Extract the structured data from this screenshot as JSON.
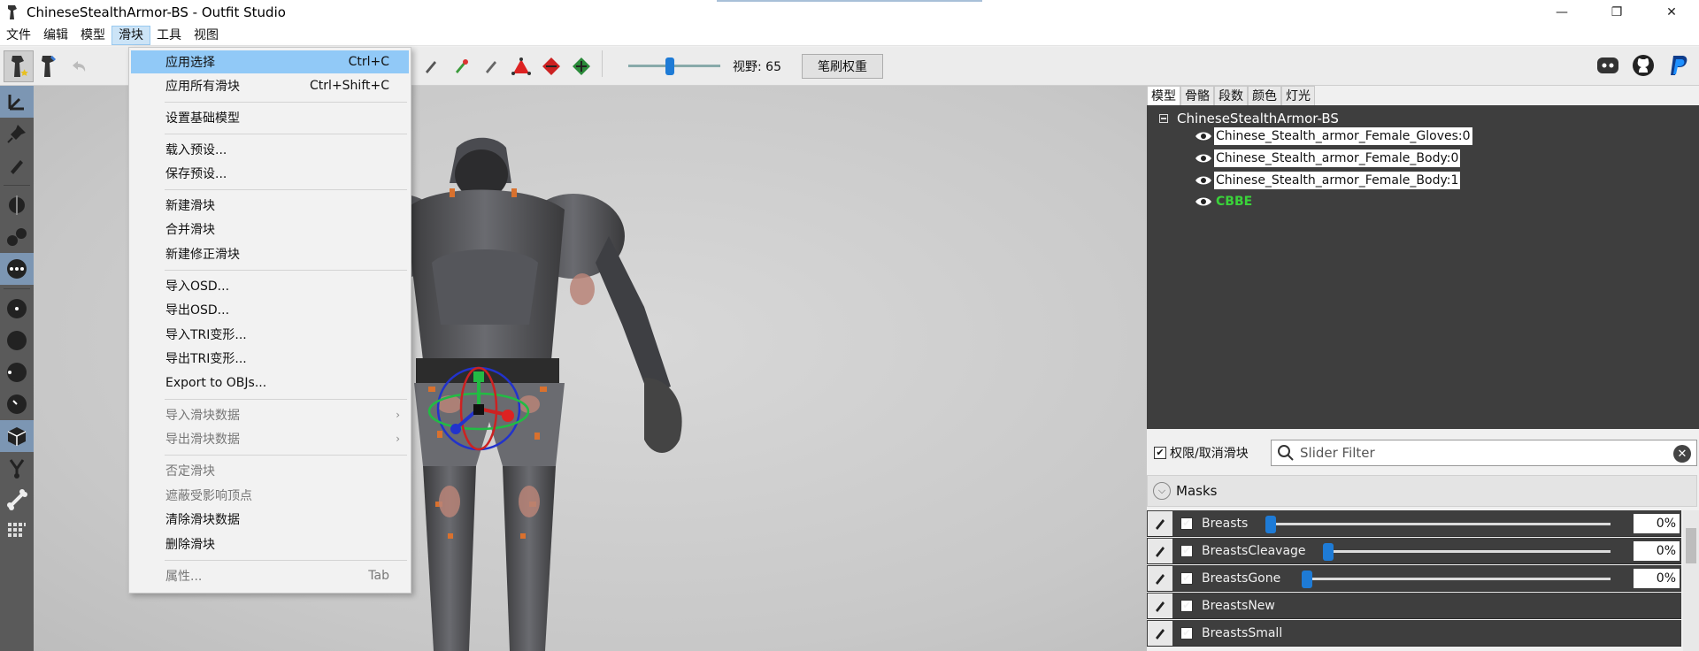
{
  "window": {
    "title": "ChineseStealthArmor-BS - Outfit Studio",
    "minimize": "—",
    "maximize": "❐",
    "close": "✕"
  },
  "menubar": [
    "文件",
    "编辑",
    "模型",
    "滑块",
    "工具",
    "视图"
  ],
  "toolbar": {
    "fov_label": "视野: 65",
    "brush_weight_button": "笔刷权重",
    "fov_value": 65
  },
  "slider_menu": {
    "items": [
      {
        "label": "应用选择",
        "shortcut": "Ctrl+C",
        "highlighted": true
      },
      {
        "label": "应用所有滑块",
        "shortcut": "Ctrl+Shift+C"
      },
      {
        "label": "设置基础模型"
      },
      {
        "label": "载入预设..."
      },
      {
        "label": "保存预设..."
      },
      {
        "label": "新建滑块"
      },
      {
        "label": "合并滑块"
      },
      {
        "label": "新建修正滑块"
      },
      {
        "label": "导入OSD..."
      },
      {
        "label": "导出OSD..."
      },
      {
        "label": "导入TRI变形..."
      },
      {
        "label": "导出TRI变形..."
      },
      {
        "label": "Export to OBJs..."
      },
      {
        "label": "导入滑块数据",
        "disabled": true,
        "submenu": true
      },
      {
        "label": "导出滑块数据",
        "disabled": true,
        "submenu": true
      },
      {
        "label": "否定滑块",
        "disabled": true
      },
      {
        "label": "遮蔽受影响顶点",
        "disabled": true
      },
      {
        "label": "清除滑块数据"
      },
      {
        "label": "删除滑块"
      },
      {
        "label": "属性...",
        "shortcut": "Tab",
        "disabled": true
      }
    ]
  },
  "panel": {
    "tabs": [
      "模型",
      "骨骼",
      "段数",
      "颜色",
      "灯光"
    ],
    "project_name": "ChineseStealthArmor-BS",
    "shapes": [
      "Chinese_Stealth_armor_Female_Gloves:0",
      "Chinese_Stealth_armor_Female_Body:0",
      "Chinese_Stealth_armor_Female_Body:1",
      "CBBE"
    ],
    "slider_toggle_label": "权限/取消滑块",
    "filter_placeholder": "Slider Filter",
    "masks_label": "Masks",
    "sliders": [
      {
        "name": "Breasts",
        "value": "0%",
        "level": 0
      },
      {
        "name": "BreastsCleavage",
        "value": "0%",
        "level": 0
      },
      {
        "name": "BreastsGone",
        "value": "0%",
        "level": 0
      },
      {
        "name": "BreastsNew",
        "value": "",
        "level": 0
      },
      {
        "name": "BreastsSmall",
        "value": "",
        "level": 0
      }
    ]
  },
  "colors": {
    "accent": "#1e7bd6",
    "menu_highlight": "#91c9f7",
    "reference_shape": "#3ad33a",
    "panel_dark": "#3e3e3e"
  }
}
